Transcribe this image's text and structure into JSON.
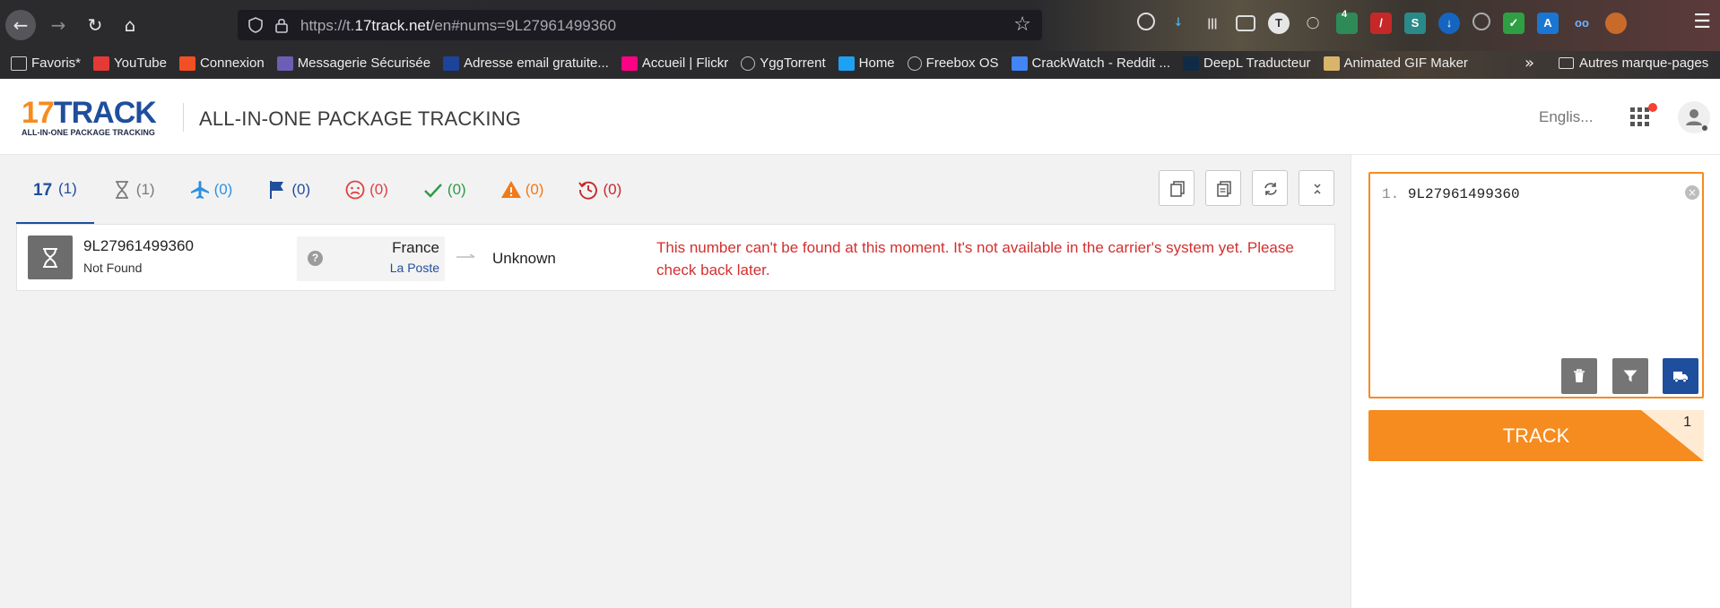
{
  "browser": {
    "url_prefix": "https://t.",
    "url_host": "17track.net",
    "url_path": "/en#nums=9L27961499360",
    "extension_badge": "4",
    "bookmarks": [
      {
        "label": "Favoris*",
        "icon": "folder-icon",
        "color": "#cfcfcf"
      },
      {
        "label": "YouTube",
        "icon": "youtube-icon",
        "color": "#e53935"
      },
      {
        "label": "Connexion",
        "icon": "microsoft-icon",
        "color": "#f25022"
      },
      {
        "label": "Messagerie Sécurisée",
        "icon": "protonmail-icon",
        "color": "#6b5fb5"
      },
      {
        "label": "Adresse email gratuite...",
        "icon": "gmx-icon",
        "color": "#1c449b"
      },
      {
        "label": "Accueil | Flickr",
        "icon": "flickr-icon",
        "color": "#ff0084"
      },
      {
        "label": "YggTorrent",
        "icon": "globe-icon",
        "color": "#bdbdbd"
      },
      {
        "label": "Home",
        "icon": "twitter-icon",
        "color": "#1da1f2"
      },
      {
        "label": "Freebox OS",
        "icon": "globe-icon",
        "color": "#bdbdbd"
      },
      {
        "label": "CrackWatch - Reddit ...",
        "icon": "google-icon",
        "color": "#4285f4"
      },
      {
        "label": "DeepL Traducteur",
        "icon": "deepl-icon",
        "color": "#0f2b46"
      },
      {
        "label": "Animated GIF Maker",
        "icon": "gif-icon",
        "color": "#d8b56a"
      }
    ],
    "other_bookmarks": "Autres marque-pages"
  },
  "header": {
    "logo_main": "17TRACK",
    "logo_tagline": "ALL-IN-ONE PACKAGE TRACKING",
    "title": "ALL-IN-ONE PACKAGE TRACKING",
    "language": "Englis..."
  },
  "tabs": [
    {
      "name": "tab-all",
      "icon": "17track-icon",
      "count": "(1)",
      "color": "#1f4e9c"
    },
    {
      "name": "tab-not-found",
      "icon": "hourglass-icon",
      "count": "(1)",
      "color": "#7a7a7a"
    },
    {
      "name": "tab-in-transit",
      "icon": "airplane-icon",
      "count": "(0)",
      "color": "#2f90e0"
    },
    {
      "name": "tab-pick-up",
      "icon": "flag-icon",
      "count": "(0)",
      "color": "#1f4e9c"
    },
    {
      "name": "tab-undelivered",
      "icon": "sad-face-icon",
      "count": "(0)",
      "color": "#e04040"
    },
    {
      "name": "tab-delivered",
      "icon": "check-icon",
      "count": "(0)",
      "color": "#2e9b44"
    },
    {
      "name": "tab-alert",
      "icon": "warning-icon",
      "count": "(0)",
      "color": "#f07a1a"
    },
    {
      "name": "tab-expired",
      "icon": "history-icon",
      "count": "(0)",
      "color": "#c62828"
    }
  ],
  "result": {
    "number": "9L27961499360",
    "status": "Not Found",
    "origin_country": "France",
    "carrier": "La Poste",
    "destination": "Unknown",
    "message": "This number can't be found at this moment. It's not available in the carrier's system yet. Please check back later."
  },
  "sidebar": {
    "line_number": "1.",
    "input_value": "9L27961499360",
    "track_label": "TRACK",
    "track_count": "1"
  },
  "colors": {
    "brand_blue": "#1f4e9c",
    "brand_orange": "#f68b1f",
    "error_red": "#d3302f"
  }
}
